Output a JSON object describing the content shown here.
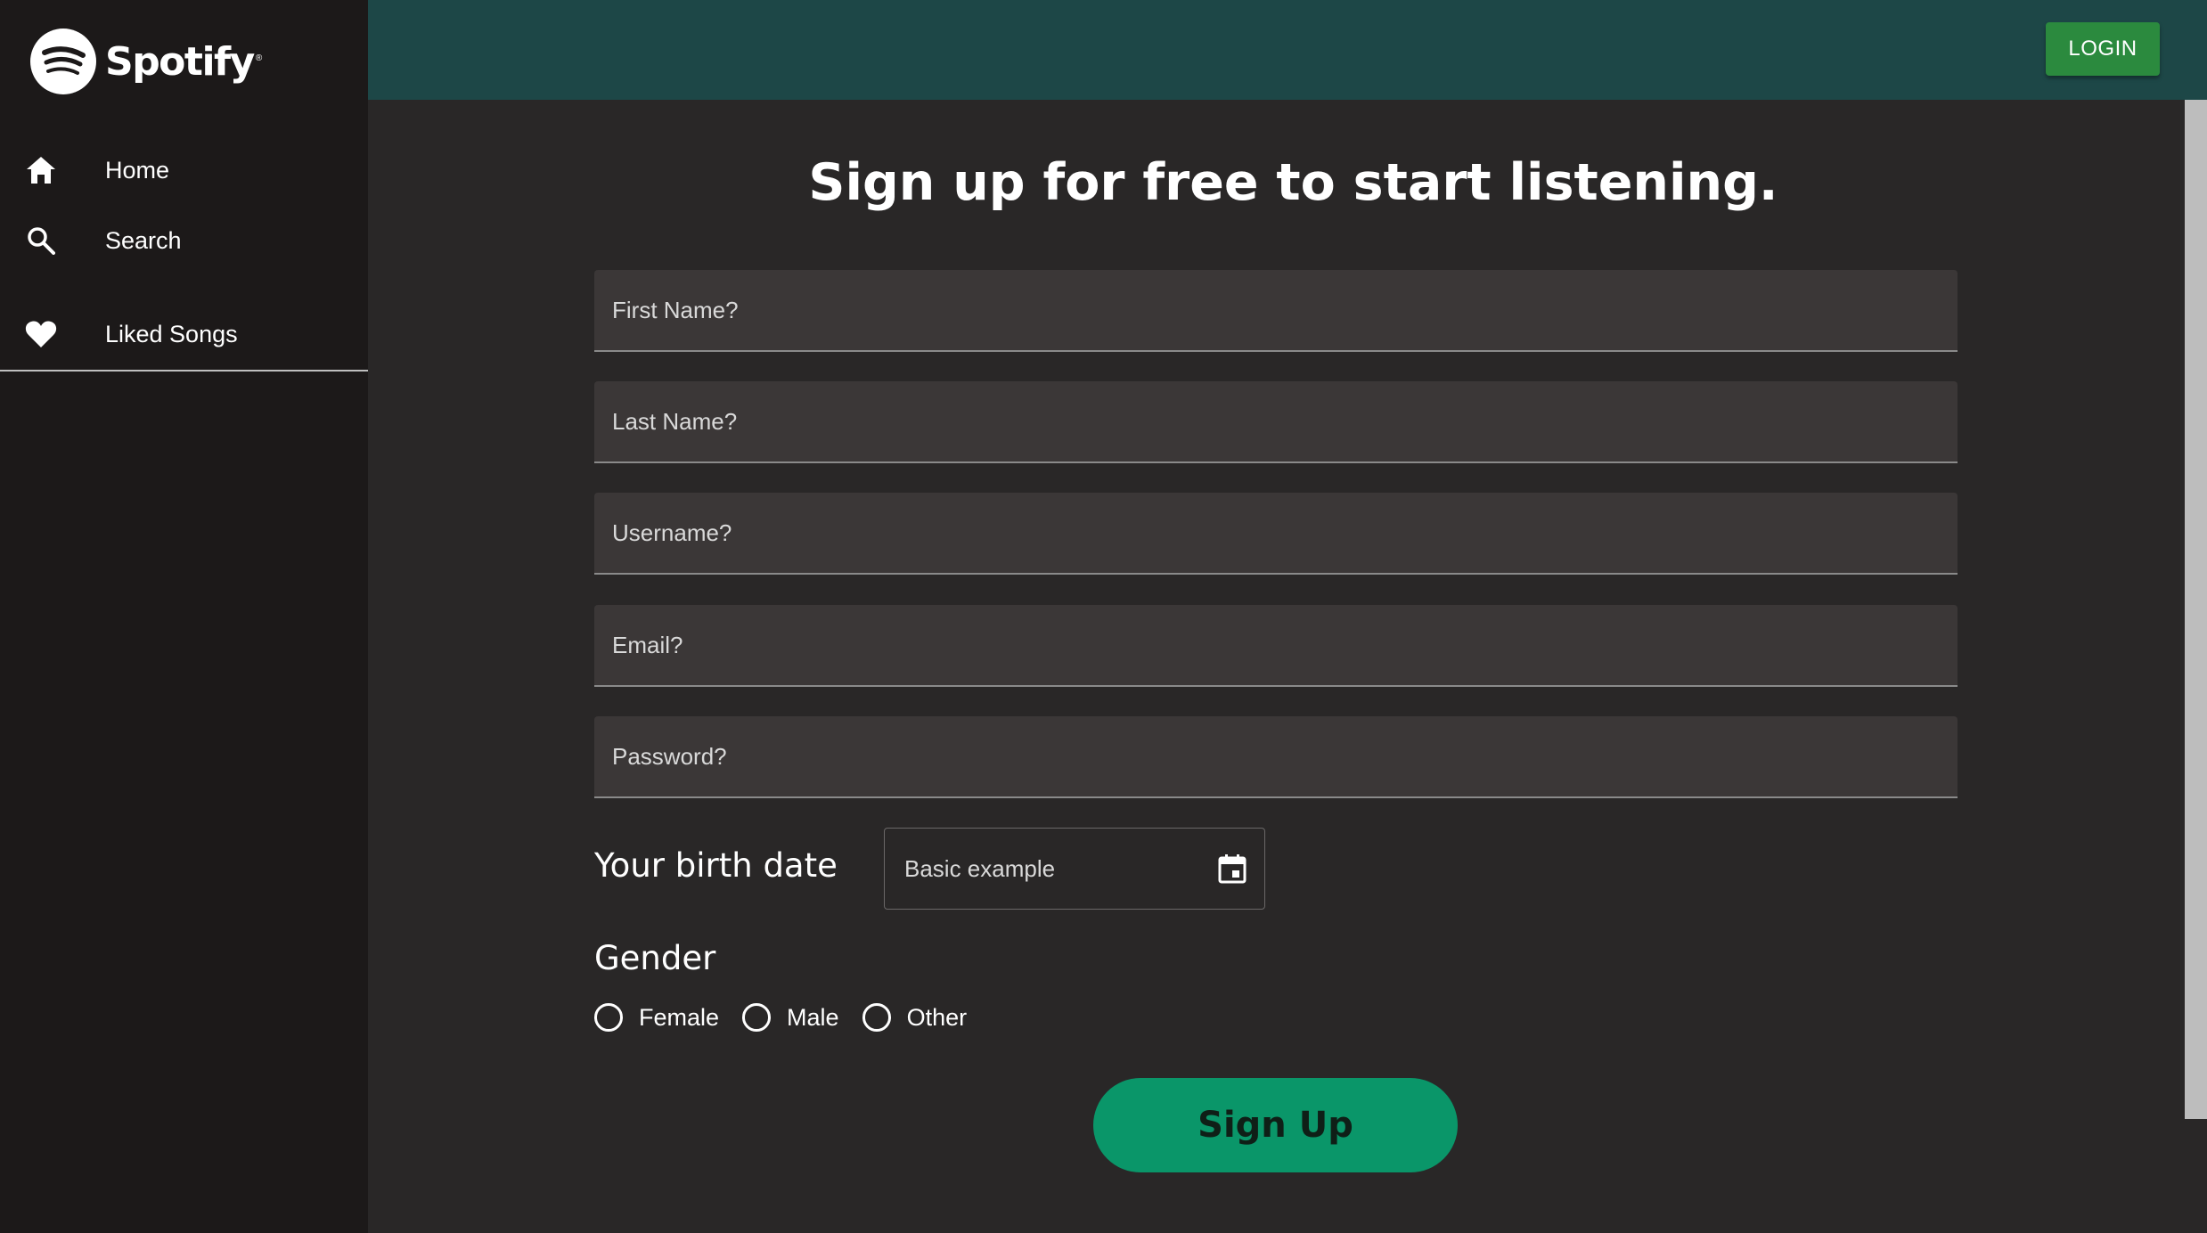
{
  "app": {
    "brand": "Spotify",
    "brand_mark": "®"
  },
  "sidebar": {
    "items": [
      {
        "label": "Home",
        "icon": "home-icon"
      },
      {
        "label": "Search",
        "icon": "search-icon"
      },
      {
        "label": "Liked Songs",
        "icon": "heart-icon"
      }
    ]
  },
  "header": {
    "login_label": "LOGIN"
  },
  "main": {
    "title": "Sign up for free to start listening.",
    "fields": {
      "first_name": {
        "placeholder": "First Name?",
        "value": ""
      },
      "last_name": {
        "placeholder": "Last Name?",
        "value": ""
      },
      "username": {
        "placeholder": "Username?",
        "value": ""
      },
      "email": {
        "placeholder": "Email?",
        "value": ""
      },
      "password": {
        "placeholder": "Password?",
        "value": ""
      }
    },
    "birth_date": {
      "label": "Your birth date",
      "placeholder": "Basic example",
      "icon": "calendar-icon"
    },
    "gender": {
      "label": "Gender",
      "options": [
        "Female",
        "Male",
        "Other"
      ],
      "selected": null
    },
    "signup_label": "Sign Up"
  },
  "colors": {
    "sidebar_bg": "#1c1919",
    "header_bg": "#1d4747",
    "main_bg": "#292727",
    "field_bg": "#3b3737",
    "login_button": "#2b8a3e",
    "signup_button": "#0a9669"
  }
}
